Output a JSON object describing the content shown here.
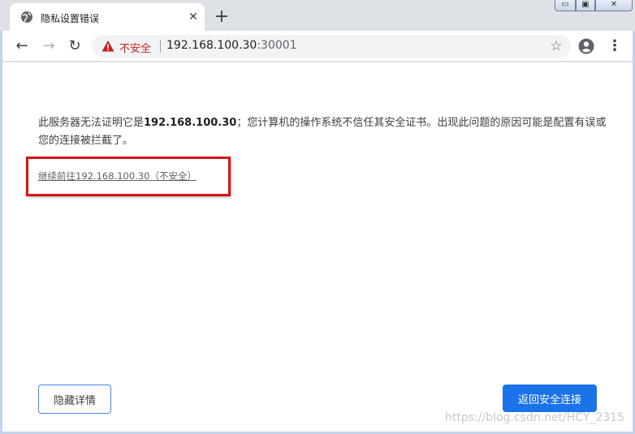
{
  "tab": {
    "title": "隐私设置错误",
    "close_glyph": "✕",
    "new_tab_glyph": "+"
  },
  "window_controls": {
    "minimize_glyph": "▭",
    "maximize_glyph": "▣",
    "close_glyph": "✕"
  },
  "toolbar": {
    "back_glyph": "←",
    "forward_glyph": "→",
    "reload_glyph": "↻",
    "security_label": "不安全",
    "url_host": "192.168.100.30",
    "url_port": ":30001",
    "star_glyph": "☆",
    "menu_glyph": "⋮"
  },
  "content": {
    "explanation_prefix": "此服务器无法证明它是",
    "explanation_host": "192.168.100.30",
    "explanation_suffix": "；您计算机的操作系统不信任其安全证书。出现此问题的原因可能是配置有误或您的连接被拦截了。",
    "proceed_link": "继续前往192.168.100.30（不安全）",
    "hide_details_button": "隐藏详情",
    "back_to_safety_button": "返回安全连接",
    "watermark": "https://blog.csdn.net/HCY_2315"
  },
  "colors": {
    "insecure_red": "#c5221f",
    "primary_blue": "#1a73e8",
    "highlight_red": "#d7141a"
  }
}
